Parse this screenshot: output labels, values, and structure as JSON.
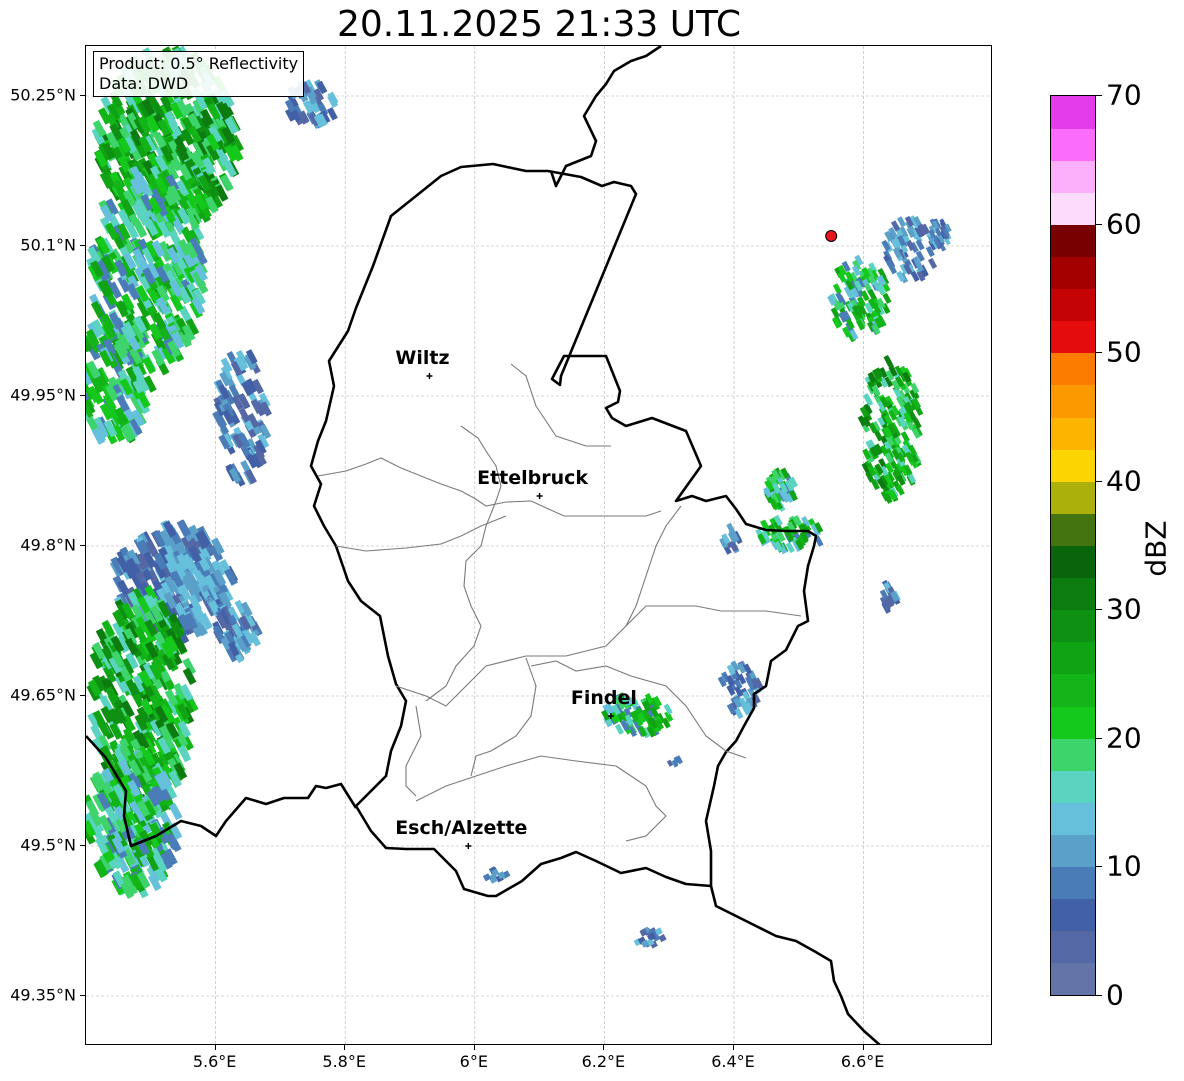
{
  "title": "20.11.2025 21:33 UTC",
  "info_box": {
    "product": "Product: 0.5° Reflectivity",
    "data": "Data: DWD"
  },
  "lat_labels": [
    "50.25°N",
    "50.1°N",
    "49.95°N",
    "49.8°N",
    "49.65°N",
    "49.5°N",
    "49.35°N"
  ],
  "lon_labels": [
    "5.6°E",
    "5.8°E",
    "6°E",
    "6.2°E",
    "6.4°E",
    "6.6°E"
  ],
  "cities": [
    {
      "name": "Wiltz",
      "lon": 5.93,
      "lat": 49.97
    },
    {
      "name": "Ettelbruck",
      "lon": 6.1,
      "lat": 49.85
    },
    {
      "name": "Findel",
      "lon": 6.21,
      "lat": 49.63
    },
    {
      "name": "Esch/Alzette",
      "lon": 5.99,
      "lat": 49.5
    }
  ],
  "map_extent": {
    "lon_min": 5.4,
    "lon_max": 6.8,
    "lat_min": 49.3,
    "lat_max": 50.3
  },
  "radar_marker": {
    "lon": 6.55,
    "lat": 50.11,
    "color": "#e8141e"
  },
  "colorbar": {
    "label": "dBZ",
    "ticks": [
      "0",
      "10",
      "20",
      "30",
      "40",
      "50",
      "60",
      "70"
    ],
    "min": 0,
    "max": 70,
    "step": 2.5,
    "colors": [
      "#6574a8",
      "#5468a6",
      "#4260a6",
      "#4a7db8",
      "#5aa0c8",
      "#66c0dc",
      "#5ad4c0",
      "#3ed46c",
      "#14c81c",
      "#12b418",
      "#10a414",
      "#0e9012",
      "#0c7c10",
      "#0a640c",
      "#447410",
      "#acb00a",
      "#fcd400",
      "#fcb400",
      "#fc9800",
      "#fc7c00",
      "#e40c0c",
      "#c40404",
      "#a40000",
      "#780000",
      "#fcdcfc",
      "#fcb0fc",
      "#fc6cfc",
      "#e43ce8"
    ]
  }
}
